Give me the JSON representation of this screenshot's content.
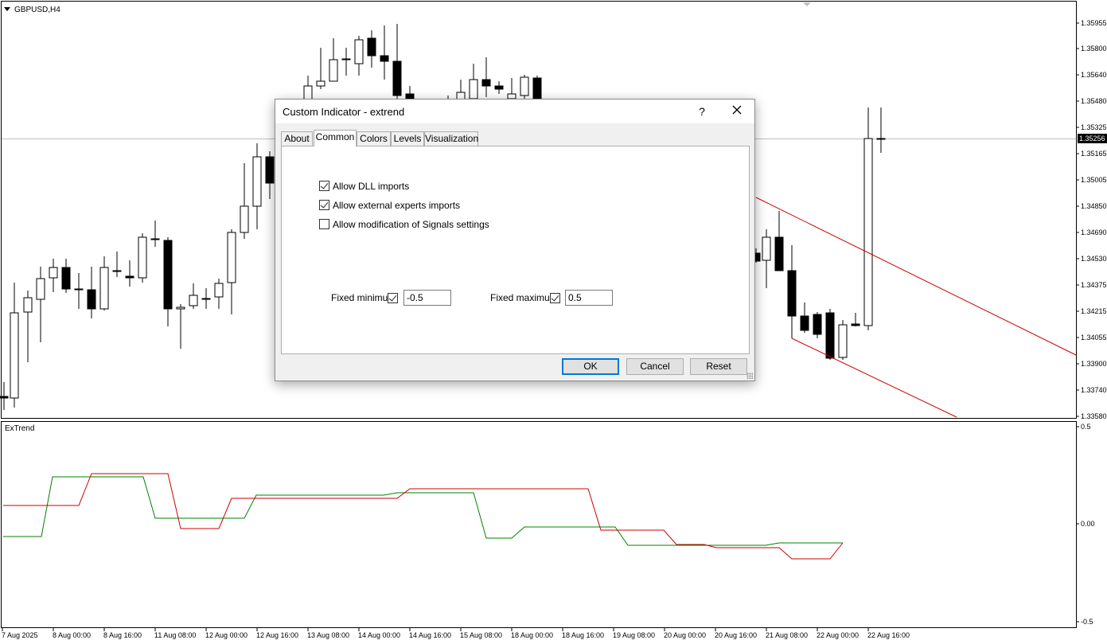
{
  "chart": {
    "symbol_label": "GBPUSD,H4",
    "current_price_label": "1.35256",
    "indicator_label": "ExTrend",
    "price_axis": [
      "1.35955",
      "1.35800",
      "1.35640",
      "1.35480",
      "1.35325",
      "1.35165",
      "1.35005",
      "1.34850",
      "1.34690",
      "1.34530",
      "1.34375",
      "1.34215",
      "1.34055",
      "1.33900",
      "1.33740",
      "1.33580"
    ],
    "indicator_axis": [
      "0.5",
      "0.00",
      "-0.5"
    ],
    "time_axis": [
      "7 Aug 2025",
      "8 Aug 00:00",
      "8 Aug 16:00",
      "11 Aug 08:00",
      "12 Aug 00:00",
      "12 Aug 16:00",
      "13 Aug 08:00",
      "14 Aug 00:00",
      "14 Aug 16:00",
      "15 Aug 08:00",
      "18 Aug 00:00",
      "18 Aug 16:00",
      "19 Aug 08:00",
      "20 Aug 00:00",
      "20 Aug 16:00",
      "21 Aug 08:00",
      "22 Aug 00:00",
      "22 Aug 16:00"
    ],
    "colors": {
      "candle_up": "#ffffff",
      "candle_down": "#000000",
      "trendline": "#cc0000",
      "indicator_green": "#008000",
      "indicator_red": "#cc0000"
    }
  },
  "dialog": {
    "title": "Custom Indicator - extrend",
    "help_label": "?",
    "close_icon": "close-icon",
    "tabs": [
      {
        "label": "About",
        "active": false
      },
      {
        "label": "Common",
        "active": true
      },
      {
        "label": "Colors",
        "active": false
      },
      {
        "label": "Levels",
        "active": false
      },
      {
        "label": "Visualization",
        "active": false
      }
    ],
    "checkboxes": [
      {
        "label": "Allow DLL imports",
        "checked": true
      },
      {
        "label": "Allow external experts imports",
        "checked": true
      },
      {
        "label": "Allow modification of Signals settings",
        "checked": false
      }
    ],
    "fixed_minimum": {
      "label": "Fixed minimum",
      "checked": true,
      "value": "-0.5"
    },
    "fixed_maximum": {
      "label": "Fixed maximum",
      "checked": true,
      "value": "0.5"
    },
    "buttons": {
      "ok": "OK",
      "cancel": "Cancel",
      "reset": "Reset"
    }
  }
}
